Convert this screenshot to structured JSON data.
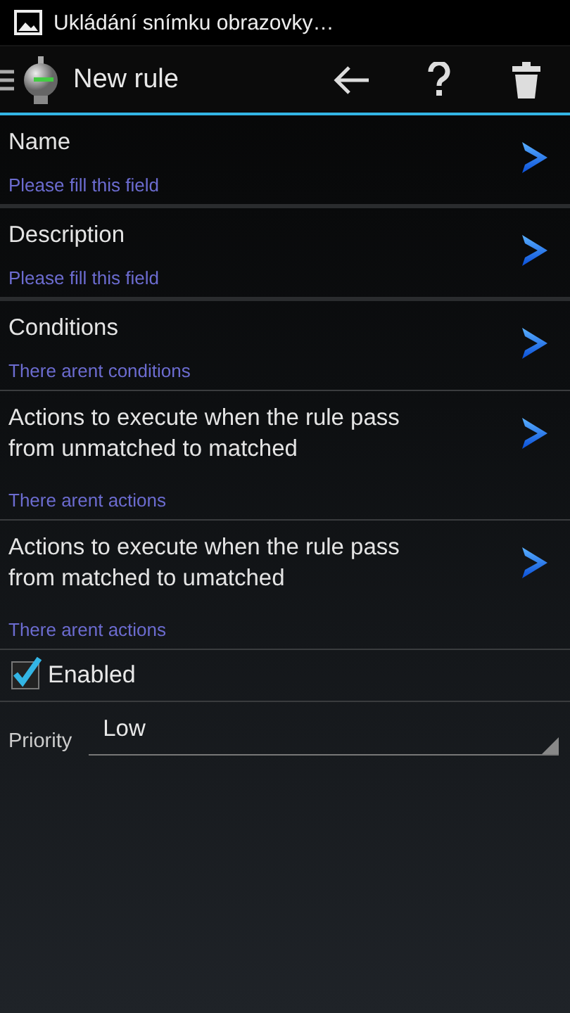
{
  "status_bar": {
    "notification": "Ukládání snímku obrazovky…"
  },
  "action_bar": {
    "title": "New rule",
    "actions": [
      {
        "kind": "back"
      },
      {
        "kind": "help"
      },
      {
        "kind": "delete"
      }
    ]
  },
  "fields": [
    {
      "label": "Name",
      "hint": "Please fill this field"
    },
    {
      "label": "Description",
      "hint": "Please fill this field"
    },
    {
      "label": "Conditions",
      "hint": "There arent conditions"
    },
    {
      "label": "Actions to execute when the rule pass from unmatched to matched",
      "hint": "There arent actions"
    },
    {
      "label": "Actions to execute when the rule pass from matched to umatched",
      "hint": "There arent actions"
    }
  ],
  "enabled": {
    "label": "Enabled",
    "checked": true
  },
  "priority": {
    "label": "Priority",
    "value": "Low"
  }
}
